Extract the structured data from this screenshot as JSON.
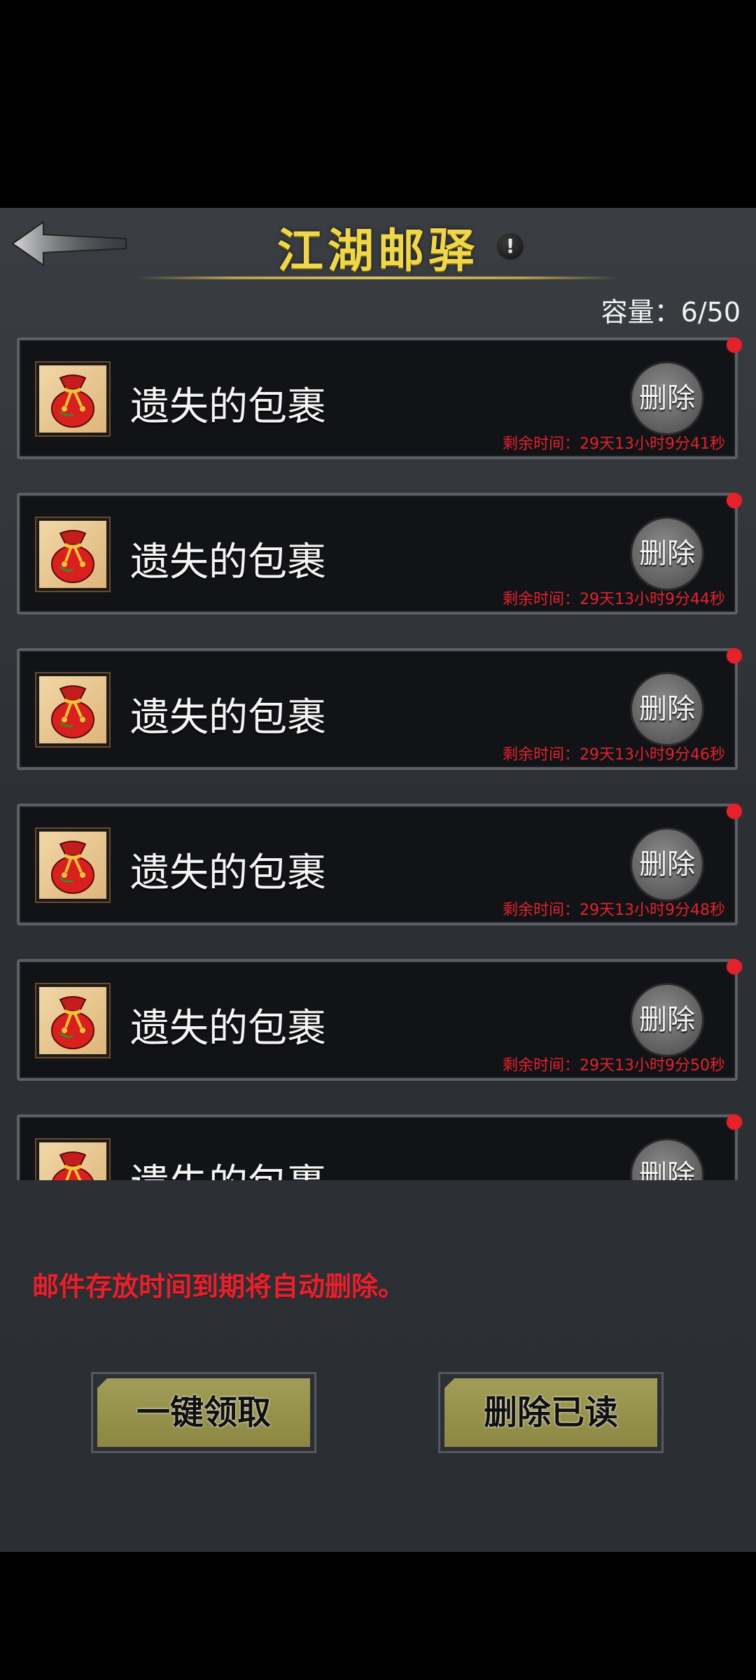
{
  "header": {
    "title": "江湖邮驿",
    "info_icon": "!",
    "capacity_label": "容量：",
    "capacity_value": "6/50"
  },
  "mails": [
    {
      "title": "遗失的包裹",
      "delete_label": "删除",
      "remaining": "剩余时间：29天13小时9分41秒",
      "unread": true,
      "icon": "red-pouch-icon"
    },
    {
      "title": "遗失的包裹",
      "delete_label": "删除",
      "remaining": "剩余时间：29天13小时9分44秒",
      "unread": true,
      "icon": "red-pouch-icon"
    },
    {
      "title": "遗失的包裹",
      "delete_label": "删除",
      "remaining": "剩余时间：29天13小时9分46秒",
      "unread": true,
      "icon": "red-pouch-icon"
    },
    {
      "title": "遗失的包裹",
      "delete_label": "删除",
      "remaining": "剩余时间：29天13小时9分48秒",
      "unread": true,
      "icon": "red-pouch-icon"
    },
    {
      "title": "遗失的包裹",
      "delete_label": "删除",
      "remaining": "剩余时间：29天13小时9分50秒",
      "unread": true,
      "icon": "red-pouch-icon"
    },
    {
      "title": "遗失的包裹",
      "delete_label": "删除",
      "remaining": "",
      "unread": true,
      "icon": "red-pouch-icon"
    }
  ],
  "notice": "邮件存放时间到期将自动删除。",
  "footer": {
    "claim_all_label": "一键领取",
    "delete_read_label": "删除已读"
  },
  "colors": {
    "title": "#f0d64a",
    "alert_red": "#e3222e",
    "button_olive": "#9a9550"
  }
}
